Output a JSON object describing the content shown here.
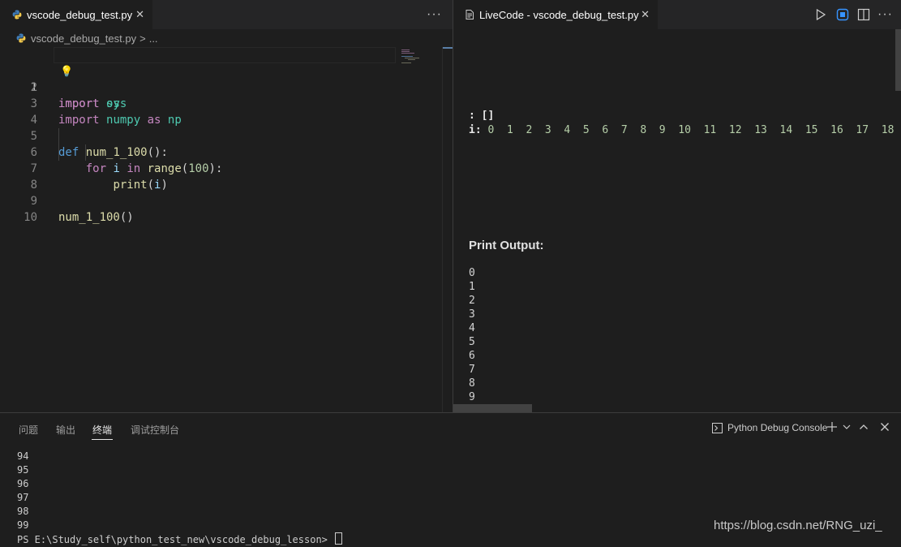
{
  "left_editor": {
    "tab_label": "vscode_debug_test.py",
    "close_glyph": "✕",
    "more_glyph": "···",
    "breadcrumb": {
      "file": "vscode_debug_test.py",
      "separator": ">",
      "more": "..."
    },
    "line_numbers": [
      "1",
      "2",
      "3",
      "4",
      "5",
      "6",
      "7",
      "8",
      "9",
      "10"
    ]
  },
  "right_editor": {
    "tab_label": "LiveCode - vscode_debug_test.py",
    "close_glyph": "✕",
    "more_glyph": "···",
    "variables": [
      {
        "name": ": ",
        "value": "[]"
      },
      {
        "name": "i: ",
        "value": "0  1  2  3  4  5  6  7  8  9  10  11  12  13  14  15  16  17  18"
      }
    ],
    "print_output_title": "Print Output:",
    "print_output": [
      "0",
      "1",
      "2",
      "3",
      "4",
      "5",
      "6",
      "7",
      "8",
      "9"
    ]
  },
  "panel": {
    "tabs": [
      "问题",
      "输出",
      "终端",
      "调试控制台"
    ],
    "active_tab": "终端",
    "console_name": "Python Debug Console",
    "terminal_lines": [
      "94",
      "95",
      "96",
      "97",
      "98",
      "99"
    ],
    "prompt": "PS E:\\Study_self\\python_test_new\\vscode_debug_lesson> "
  },
  "watermark": "https://blog.csdn.net/RNG_uzi_",
  "icons": {
    "python_file": "python-file-icon",
    "run": "run-icon",
    "stop": "stop-icon",
    "split": "split-editor-icon",
    "terminal": "terminal-icon",
    "lightbulb": "lightbulb-icon"
  },
  "colors": {
    "background": "#1e1e1e",
    "keyword": "#c586c0",
    "keyword_def": "#569cd6",
    "module": "#4ec9b0",
    "function": "#dcdcaa",
    "number": "#b5cea8",
    "variable": "#9cdcfe"
  }
}
